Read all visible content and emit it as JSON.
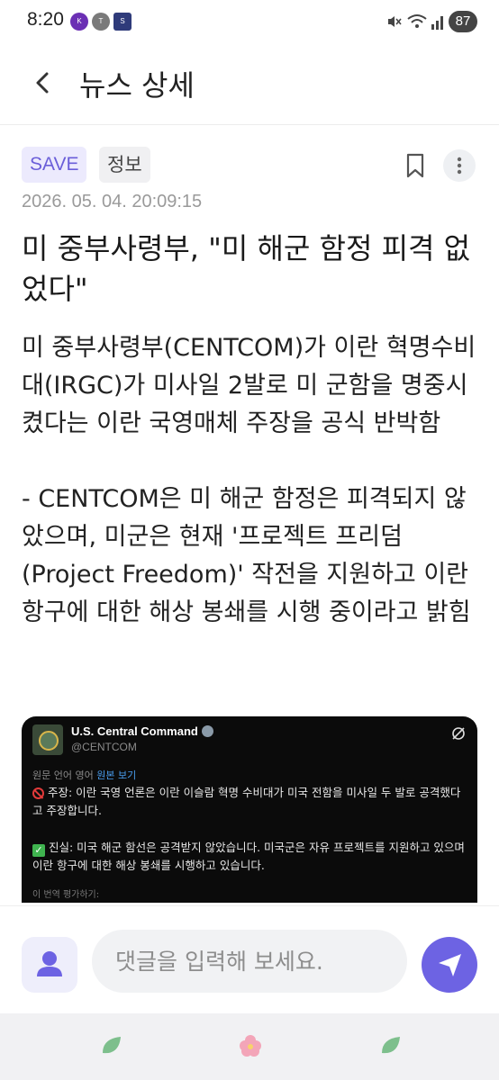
{
  "status_bar": {
    "time": "8:20",
    "apps": [
      "Kurly",
      "TALK",
      "SAVE"
    ],
    "battery": "87"
  },
  "app_bar": {
    "title": "뉴스 상세",
    "back_icon": "chevron-left-icon"
  },
  "article": {
    "tags": [
      "SAVE",
      "정보"
    ],
    "timestamp": "2026. 05. 04. 20:09:15",
    "headline": "미 중부사령부, \"미 해군 함정 피격 없었다\"",
    "body": "미 중부사령부(CENTCOM)가 이란 혁명수비대(IRGC)가 미사일 2발로 미 군함을 명중시켰다는 이란 국영매체 주장을 공식 반박함\n\n- CENTCOM은 미 해군 함정은 피격되지 않았으며, 미군은 현재 '프로젝트 프리덤(Project Freedom)' 작전을 지원하고 이란 항구에 대한 해상 봉쇄를 시행 중이라고 밝힘"
  },
  "embed": {
    "account_name": "U.S. Central Command",
    "handle": "@CENTCOM",
    "translation_note": "원문 언어 영어",
    "translation_link": "원본 보기",
    "claim": "주장: 이란 국영 언론은 이란 이슬람 혁명 수비대가 미국 전함을 미사일 두 발로 공격했다고 주장합니다.",
    "fact": "진실: 미국 해군 함선은 공격받지 않았습니다. 미국군은 자유 프로젝트를 지원하고 있으며 이란 항구에 대한 해상 봉쇄를 시행하고 있습니다.",
    "rate": "이 번역 평가하기:"
  },
  "composer": {
    "placeholder": "댓글을 입력해 보세요."
  },
  "colors": {
    "accent": "#6d63e3",
    "tag_save_bg": "#eceafd",
    "tag_info_bg": "#f0f0f2"
  }
}
